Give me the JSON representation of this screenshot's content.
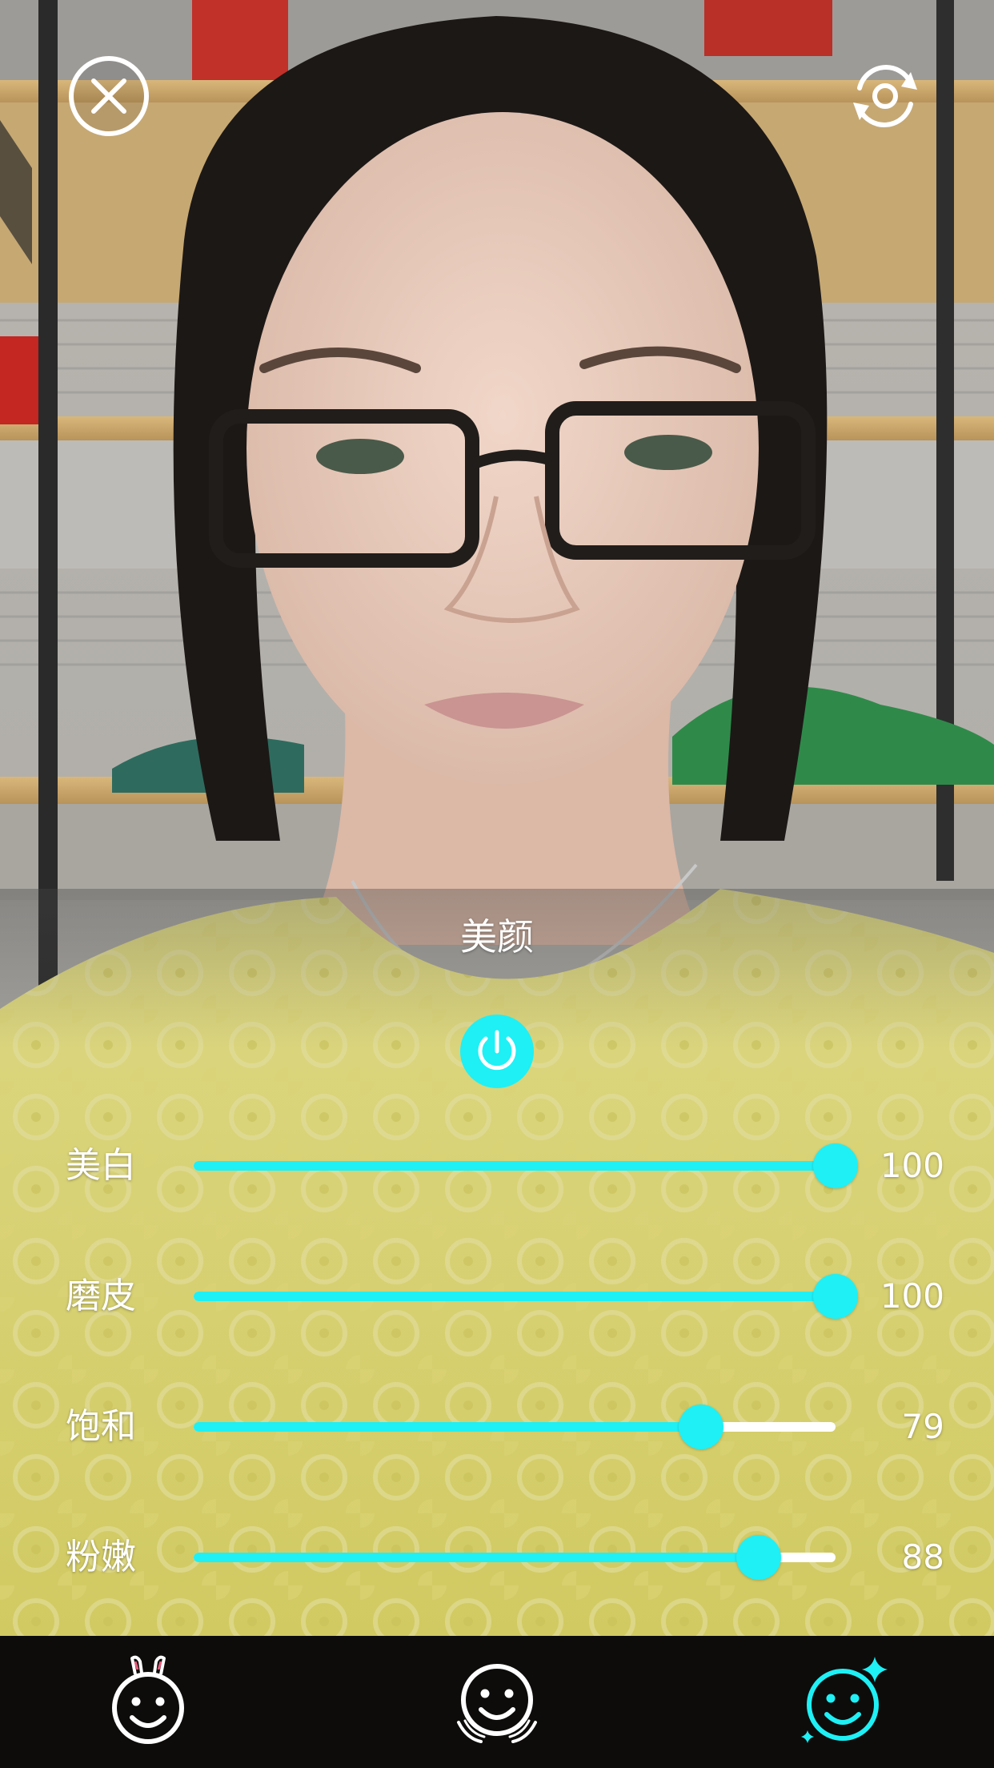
{
  "panel": {
    "title": "美颜",
    "power_on": true
  },
  "sliders": [
    {
      "label": "美白",
      "value": "100",
      "fraction": 1.0
    },
    {
      "label": "磨皮",
      "value": "100",
      "fraction": 1.0
    },
    {
      "label": "饱和",
      "value": "79",
      "fraction": 0.79
    },
    {
      "label": "粉嫩",
      "value": "88",
      "fraction": 0.88
    }
  ],
  "top_bar": {
    "close_icon": "close-icon",
    "flip_icon": "flip-camera-icon"
  },
  "bottom_tabs": [
    {
      "icon": "bunny-face-icon",
      "active": false
    },
    {
      "icon": "face-reshape-icon",
      "active": false
    },
    {
      "icon": "sparkle-face-icon",
      "active": true
    }
  ],
  "colors": {
    "accent": "#1ef0f5",
    "icon_white": "#ffffff",
    "bottom_bar": "#0d0c0b"
  }
}
